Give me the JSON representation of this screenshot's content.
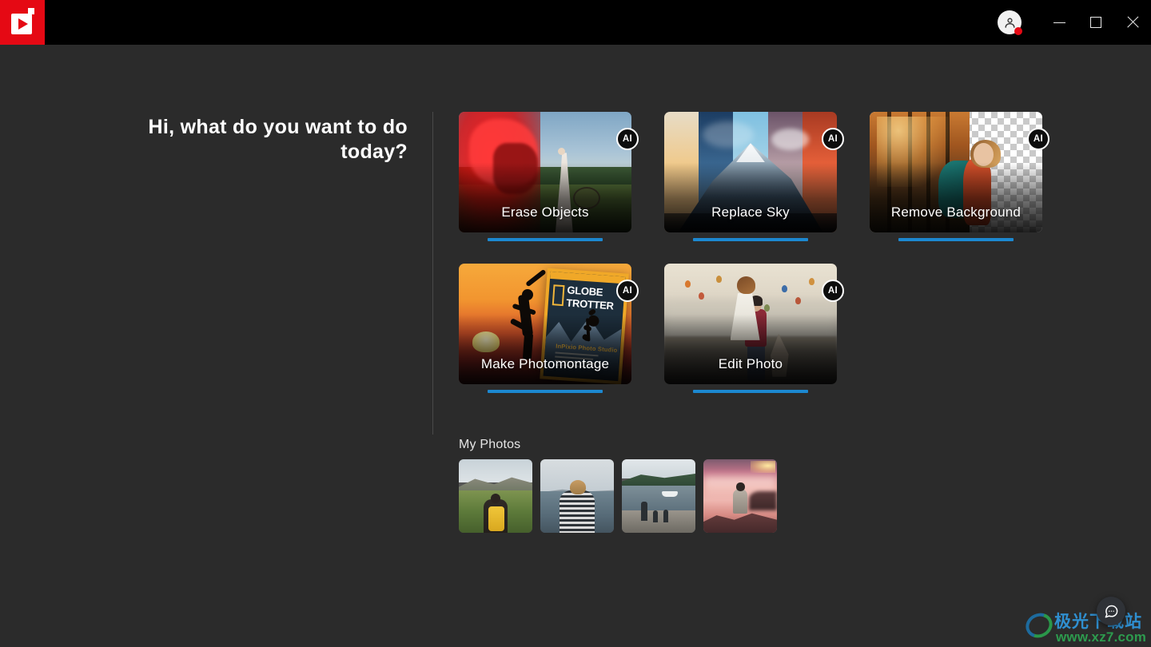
{
  "app": {
    "logo_icon": "play-logo-icon",
    "background_color": "#2b2b2b",
    "accent_color": "#1c88d0",
    "brand_color": "#e50914"
  },
  "titlebar": {
    "account": {
      "icon": "user-avatar-icon",
      "badge": "notification-dot"
    },
    "minimize_label": "Minimize",
    "maximize_label": "Maximize",
    "close_label": "Close"
  },
  "greeting": {
    "text": "Hi, what do you want to do today?"
  },
  "features": {
    "ai_badge_label": "AI",
    "cards": [
      {
        "label": "Erase Objects",
        "ai": "AI"
      },
      {
        "label": "Replace Sky",
        "ai": "AI"
      },
      {
        "label": "Remove Background",
        "ai": "AI"
      },
      {
        "label": "Make Photomontage",
        "ai": "AI"
      },
      {
        "label": "Edit Photo",
        "ai": "AI"
      }
    ]
  },
  "magazine": {
    "title_line1": "GLOBE",
    "title_line2": "TROTTER",
    "subtitle": "InPixio Photo Studio"
  },
  "my_photos": {
    "title": "My Photos",
    "thumbnails": [
      {
        "name": "hiker-mountain-valley"
      },
      {
        "name": "woman-striped-shirt-lake"
      },
      {
        "name": "family-shore-boat"
      },
      {
        "name": "person-rock-pink-sunset"
      }
    ]
  },
  "chat": {
    "icon": "chat-bubble-icon",
    "label": "Support chat"
  },
  "watermark": {
    "site_name": "极光下载站",
    "url": "www.xz7.com"
  }
}
